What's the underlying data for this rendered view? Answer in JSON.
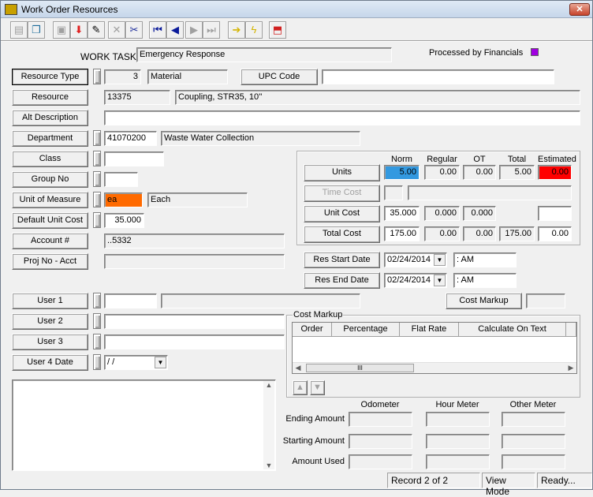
{
  "window": {
    "title": "Work Order Resources",
    "close": "✕"
  },
  "toolbar": [
    {
      "name": "properties-icon",
      "glyph": "▤",
      "color": "#a0a0a0"
    },
    {
      "name": "copy-record-icon",
      "glyph": "❐",
      "color": "#1a6a9a"
    },
    {
      "name": "save-icon",
      "glyph": "▣",
      "color": "#a0a0a0"
    },
    {
      "name": "add-record-icon",
      "glyph": "⬇",
      "color": "#e02020"
    },
    {
      "name": "edit-pencil-icon",
      "glyph": "✎",
      "color": "#000"
    },
    {
      "name": "delete-icon",
      "glyph": "✕",
      "color": "#a0a0a0"
    },
    {
      "name": "cut-icon",
      "glyph": "✂",
      "color": "#1a2a9a"
    },
    {
      "name": "first-record-icon",
      "glyph": "⏮",
      "color": "#0a1a9a"
    },
    {
      "name": "previous-record-icon",
      "glyph": "◀",
      "color": "#0a1a9a"
    },
    {
      "name": "next-record-icon",
      "glyph": "▶",
      "color": "#a0a0a0"
    },
    {
      "name": "last-record-icon",
      "glyph": "⏭",
      "color": "#a0a0a0"
    },
    {
      "name": "go-arrow-icon",
      "glyph": "➔",
      "color": "#d4b400"
    },
    {
      "name": "lightning-icon",
      "glyph": "ϟ",
      "color": "#d4b400"
    },
    {
      "name": "exit-icon",
      "glyph": "⬒",
      "color": "#d02020"
    }
  ],
  "header": {
    "work_task_label": "WORK TASK",
    "work_task": "Emergency Response",
    "processed_label": "Processed by Financials",
    "processed_color": "#a000e0"
  },
  "fields": {
    "resource_type_btn": "Resource Type",
    "resource_type_code": "3",
    "resource_type": "Material",
    "upc_btn": "UPC Code",
    "upc": "",
    "resource_btn": "Resource",
    "resource_code": "13375",
    "resource_desc": "Coupling, STR35, 10''",
    "alt_desc_btn": "Alt Description",
    "alt_desc": "",
    "department_btn": "Department",
    "department_code": "41070200",
    "department": "Waste Water Collection",
    "class_btn": "Class",
    "class": "",
    "group_btn": "Group No",
    "group": "",
    "uom_btn": "Unit of Measure",
    "uom_code": "ea",
    "uom": "Each",
    "uom_color": "#ff6a00",
    "default_cost_btn": "Default Unit Cost",
    "default_cost": "35.000",
    "account_btn": "Account #",
    "account": "..5332",
    "proj_btn": "Proj No - Acct",
    "proj": "",
    "user1_btn": "User 1",
    "user1": "",
    "user1_desc": "",
    "user2_btn": "User 2",
    "user2": "",
    "user3_btn": "User 3",
    "user3": "",
    "user4_btn": "User 4 Date",
    "user4": " /  /",
    "memo": ""
  },
  "costs": {
    "headers": [
      "Norm",
      "Regular",
      "OT",
      "Total",
      "Estimated"
    ],
    "units_btn": "Units",
    "units": [
      "5.00",
      "0.00",
      "0.00",
      "5.00",
      "0.00"
    ],
    "units_norm_color": "#3399e0",
    "units_est_color": "#ff0000",
    "time_cost_btn": "Time Cost",
    "unit_cost_btn": "Unit Cost",
    "unit_cost": [
      "35.000",
      "0.000",
      "0.000",
      "",
      ""
    ],
    "total_cost_btn": "Total Cost",
    "total_cost": [
      "175.00",
      "0.00",
      "0.00",
      "175.00",
      "0.00"
    ]
  },
  "dates": {
    "start_btn": "Res Start Date",
    "start_date": "02/24/2014",
    "start_time": " :  AM",
    "end_btn": "Res End Date",
    "end_date": "02/24/2014",
    "end_time": " :  AM"
  },
  "markup": {
    "button": "Cost Markup",
    "value": "",
    "group_title": "Cost Markup",
    "columns": [
      "Order",
      "Percentage",
      "Flat Rate",
      "Calculate On Text"
    ],
    "scroll_thumb": "III"
  },
  "meters": {
    "headers": [
      "Odometer",
      "Hour Meter",
      "Other Meter"
    ],
    "rows": [
      "Ending Amount",
      "Starting Amount",
      "Amount Used"
    ]
  },
  "status": {
    "record": "Record 2 of 2",
    "mode": "View Mode",
    "state": "Ready..."
  }
}
